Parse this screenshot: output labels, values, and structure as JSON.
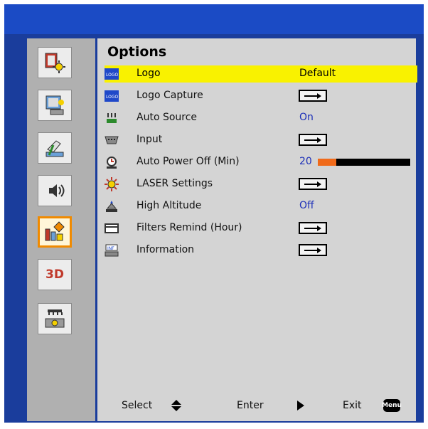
{
  "title": "Options",
  "colors": {
    "frame": "#1a3d9c",
    "highlight": "#f9f200",
    "accent": "#f06a1a",
    "value_text": "#1c2fb8"
  },
  "sidebar": {
    "items": [
      {
        "name": "image-settings-icon",
        "active": false
      },
      {
        "name": "display-settings-icon",
        "active": false
      },
      {
        "name": "setup-icon",
        "active": false
      },
      {
        "name": "volume-icon",
        "active": false
      },
      {
        "name": "options-icon",
        "active": true
      },
      {
        "name": "3d-icon",
        "active": false,
        "text": "3D"
      },
      {
        "name": "network-icon",
        "active": false
      }
    ]
  },
  "menu": {
    "rows": [
      {
        "label": "Logo",
        "value": "Default",
        "icon": "logo-icon",
        "selected": true
      },
      {
        "label": "Logo Capture",
        "control": "arrow",
        "icon": "logo-capture-icon"
      },
      {
        "label": "Auto Source",
        "value": "On",
        "icon": "auto-source-icon"
      },
      {
        "label": "Input",
        "control": "arrow",
        "icon": "input-icon"
      },
      {
        "label": "Auto Power Off (Min)",
        "value": "20",
        "level_fraction": 0.2,
        "icon": "auto-power-off-icon"
      },
      {
        "label": "LASER Settings",
        "control": "arrow",
        "icon": "laser-settings-icon"
      },
      {
        "label": "High Altitude",
        "value": "Off",
        "icon": "high-altitude-icon"
      },
      {
        "label": "Filters Remind (Hour)",
        "control": "arrow",
        "icon": "filter-icon"
      },
      {
        "label": "Information",
        "control": "arrow",
        "icon": "information-icon"
      }
    ]
  },
  "footer": {
    "select": "Select",
    "enter": "Enter",
    "exit": "Exit",
    "menu_key": "Menu"
  }
}
